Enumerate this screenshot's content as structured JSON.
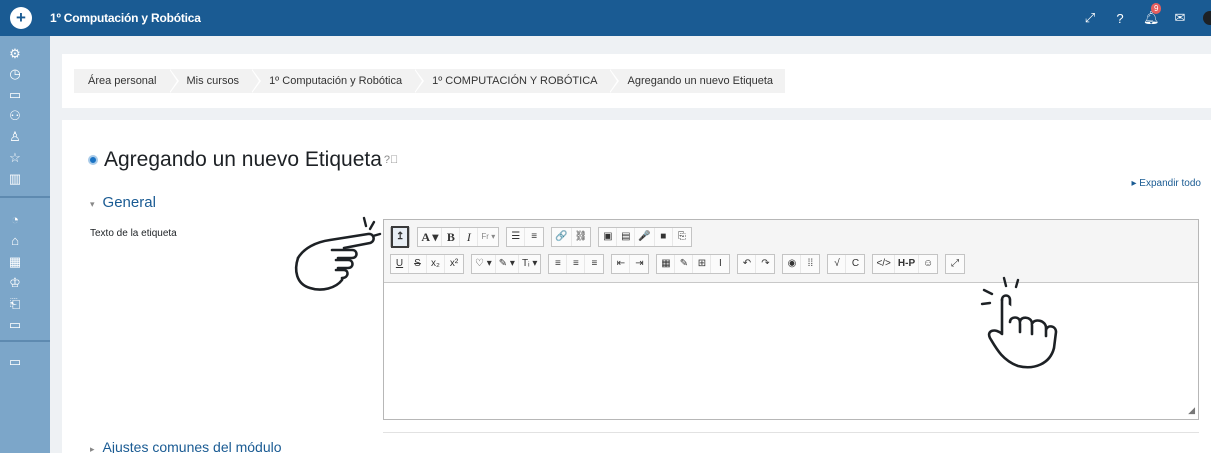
{
  "topbar": {
    "add_label": "+",
    "course_title": "1º Computación y Robótica",
    "notification_count": "9"
  },
  "icons": {
    "add": "plus-icon",
    "expand": "expand-icon",
    "help": "question-icon",
    "bell": "bell-icon",
    "mail": "envelope-icon"
  },
  "breadcrumb": [
    "Área personal",
    "Mis cursos",
    "1º Computación y Robótica",
    "1º COMPUTACIÓN Y ROBÓTICA",
    "Agregando un nuevo Etiqueta"
  ],
  "page": {
    "title": "Agregando un nuevo Etiqueta",
    "expand_all": "Expandir todo",
    "section_general": "General",
    "field_label": "Texto de la etiqueta",
    "section_common": "Ajustes comunes del módulo"
  },
  "toolbar": {
    "row1": [
      [
        "↥"
      ],
      [
        "A ▾",
        "B",
        "I",
        "Fr ▾"
      ],
      [
        "☰",
        "≡"
      ],
      [
        "🔗",
        "⛓"
      ],
      [
        "▣",
        "▤",
        "🎤",
        "■",
        "⎘"
      ]
    ],
    "row2": [
      [
        "U",
        "S",
        "x₂",
        "x²"
      ],
      [
        "♡ ▾",
        "✎ ▾",
        "Tᵢ ▾"
      ],
      [
        "≡",
        "≡",
        "≡"
      ],
      [
        "⇤",
        "⇥"
      ],
      [
        "▦",
        "✎",
        "⊞",
        "I"
      ],
      [
        "↶",
        "↷"
      ],
      [
        "◉",
        "⁞⁞"
      ],
      [
        "√",
        "C"
      ],
      [
        "</>",
        "H-P",
        "☺"
      ],
      [
        "⤢"
      ]
    ]
  },
  "colors": {
    "topbar": "#1a5b93",
    "sidebar": "#7ca6c9",
    "link": "#1a5b93",
    "badge": "#e55e5e"
  }
}
